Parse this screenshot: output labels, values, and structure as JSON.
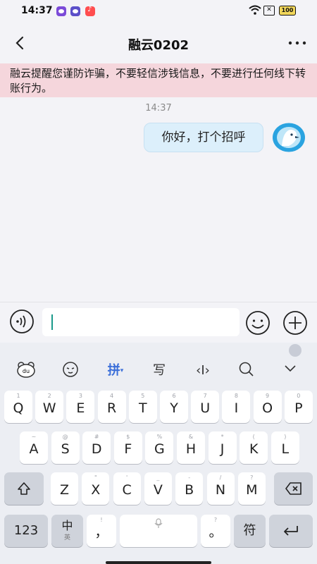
{
  "status_bar": {
    "time": "14:37",
    "battery": "100"
  },
  "chat": {
    "title": "融云0202",
    "warning": "融云提醒您谨防诈骗，不要轻信涉钱信息，不要进行任何线下转账行为。",
    "timestamp": "14:37",
    "messages": [
      {
        "text": "你好，打个招呼",
        "sender": "self"
      }
    ]
  },
  "input": {
    "value": ""
  },
  "keyboard": {
    "toolbar": {
      "pinyin": "拼",
      "handwrite": "写",
      "cursor": "‹I›"
    },
    "row1": [
      {
        "hint": "1",
        "key": "Q"
      },
      {
        "hint": "2",
        "key": "W"
      },
      {
        "hint": "3",
        "key": "E"
      },
      {
        "hint": "4",
        "key": "R"
      },
      {
        "hint": "5",
        "key": "T"
      },
      {
        "hint": "6",
        "key": "Y"
      },
      {
        "hint": "7",
        "key": "U"
      },
      {
        "hint": "8",
        "key": "I"
      },
      {
        "hint": "9",
        "key": "O"
      },
      {
        "hint": "0",
        "key": "P"
      }
    ],
    "row2": [
      {
        "hint": "~",
        "key": "A"
      },
      {
        "hint": "@",
        "key": "S"
      },
      {
        "hint": "#",
        "key": "D"
      },
      {
        "hint": "$",
        "key": "F"
      },
      {
        "hint": "%",
        "key": "G"
      },
      {
        "hint": "&",
        "key": "H"
      },
      {
        "hint": "*",
        "key": "J"
      },
      {
        "hint": "(",
        "key": "K"
      },
      {
        "hint": ")",
        "key": "L"
      }
    ],
    "row3": [
      {
        "hint": "",
        "key": "Z"
      },
      {
        "hint": "\"",
        "key": "X"
      },
      {
        "hint": "'",
        "key": "C"
      },
      {
        "hint": "_",
        "key": "V"
      },
      {
        "hint": "-",
        "key": "B"
      },
      {
        "hint": "/",
        "key": "N"
      },
      {
        "hint": "?",
        "key": "M"
      }
    ],
    "bottom": {
      "num": "123",
      "lang": "中",
      "lang_sub": "英",
      "comma": "，",
      "comma_hint": "!",
      "period": "。",
      "period_hint": "?",
      "symbols": "符"
    },
    "accent_color": "#3b6fd9"
  }
}
